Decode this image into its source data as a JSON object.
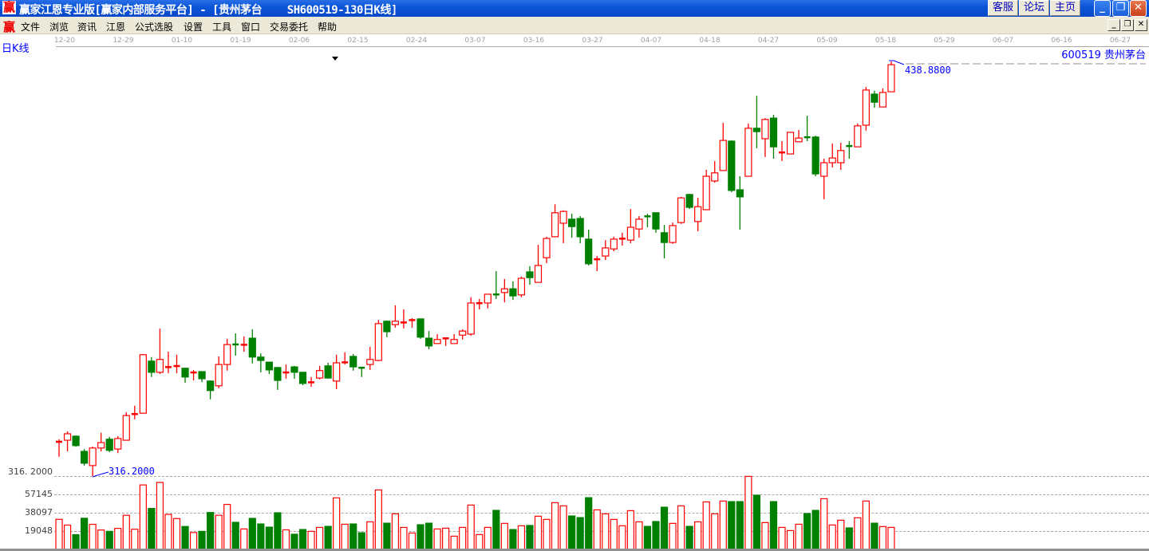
{
  "window": {
    "app_icon": "赢",
    "title": "赢家江恩专业版[赢家内部服务平台] - [贵州茅台    SH600519-130日K线]",
    "top_buttons": [
      "客服",
      "论坛",
      "主页"
    ],
    "controls": {
      "minimize": "minimize-icon",
      "restore": "restore-icon",
      "close": "close-icon"
    }
  },
  "menu": {
    "icon": "赢",
    "items": [
      "文件",
      "浏览",
      "资讯",
      "江恩",
      "公式选股",
      "设置",
      "工具",
      "窗口",
      "交易委托",
      "帮助"
    ]
  },
  "chart": {
    "period_label": "日K线",
    "stock_label": "600519 贵州茅台",
    "date_labels": [
      "12-20",
      "12-29",
      "01-10",
      "01-19",
      "02-06",
      "02-15",
      "02-24",
      "03-07",
      "03-16",
      "03-27",
      "04-07",
      "04-18",
      "04-27",
      "05-09",
      "05-18",
      "05-29",
      "06-07",
      "06-16",
      "06-27"
    ],
    "high_marker": "438.8800",
    "low_marker": "316.2000",
    "price_axis_label": "316. 2000",
    "volume_axis_labels": [
      "57145",
      "38097",
      "19048"
    ],
    "colors": {
      "up": "#FF0000",
      "down": "#008000",
      "marker": "#0000FF"
    }
  },
  "chart_data": {
    "type": "candlestick",
    "ohlc_order": [
      "open",
      "high",
      "low",
      "close"
    ],
    "price_range": [
      316.2,
      438.88
    ],
    "volume_ticks": [
      19048,
      38097,
      57145,
      76193
    ],
    "candles": [
      [
        326.2,
        327.1,
        321.9,
        326.4
      ],
      [
        326.8,
        329.4,
        323.5,
        328.7
      ],
      [
        328.0,
        328.2,
        324.9,
        325.2
      ],
      [
        323.5,
        324.2,
        319.3,
        320.0
      ],
      [
        319.3,
        324.9,
        316.2,
        324.5
      ],
      [
        324.5,
        329.0,
        323.5,
        326.1
      ],
      [
        327.1,
        327.8,
        323.3,
        323.8
      ],
      [
        324.2,
        328.0,
        323.0,
        327.3
      ],
      [
        326.8,
        335.1,
        326.8,
        334.1
      ],
      [
        334.5,
        337.0,
        333.0,
        334.6
      ],
      [
        334.8,
        352.3,
        334.8,
        352.1
      ],
      [
        350.2,
        351.4,
        345.5,
        346.9
      ],
      [
        346.9,
        359.8,
        346.4,
        350.7
      ],
      [
        348.1,
        353.0,
        346.6,
        348.5
      ],
      [
        348.7,
        352.1,
        346.6,
        348.8
      ],
      [
        348.1,
        348.1,
        343.8,
        345.5
      ],
      [
        346.8,
        347.6,
        344.5,
        346.9
      ],
      [
        347.1,
        347.1,
        344.0,
        345.0
      ],
      [
        344.3,
        344.5,
        338.9,
        341.5
      ],
      [
        342.9,
        351.6,
        342.2,
        349.2
      ],
      [
        349.2,
        356.8,
        347.4,
        355.1
      ],
      [
        355.2,
        358.4,
        351.8,
        355.1
      ],
      [
        355.0,
        357.5,
        353.0,
        355.1
      ],
      [
        357.0,
        359.6,
        349.5,
        351.4
      ],
      [
        351.4,
        352.5,
        346.9,
        350.4
      ],
      [
        349.9,
        349.9,
        346.4,
        347.6
      ],
      [
        348.3,
        348.5,
        341.7,
        344.5
      ],
      [
        346.4,
        349.2,
        345.0,
        346.9
      ],
      [
        348.5,
        348.8,
        345.0,
        346.9
      ],
      [
        346.9,
        346.9,
        343.1,
        343.6
      ],
      [
        343.9,
        345.5,
        342.6,
        344.0
      ],
      [
        345.2,
        348.8,
        344.8,
        347.4
      ],
      [
        348.8,
        349.7,
        345.0,
        345.2
      ],
      [
        344.3,
        352.1,
        341.9,
        349.7
      ],
      [
        349.8,
        352.8,
        349.2,
        349.9
      ],
      [
        351.6,
        352.3,
        347.4,
        348.5
      ],
      [
        348.3,
        348.3,
        345.5,
        348.2
      ],
      [
        349.2,
        354.4,
        347.6,
        350.7
      ],
      [
        350.4,
        362.4,
        350.2,
        361.3
      ],
      [
        362.0,
        362.2,
        357.3,
        358.9
      ],
      [
        361.0,
        366.7,
        360.1,
        362.0
      ],
      [
        361.3,
        365.5,
        359.9,
        361.7
      ],
      [
        362.3,
        362.9,
        360.1,
        362.4
      ],
      [
        362.7,
        362.7,
        356.8,
        357.3
      ],
      [
        357.0,
        359.1,
        353.7,
        354.7
      ],
      [
        355.4,
        358.2,
        355.4,
        356.6
      ],
      [
        356.9,
        357.0,
        354.7,
        357.0
      ],
      [
        355.4,
        358.2,
        355.4,
        356.6
      ],
      [
        357.9,
        359.6,
        356.6,
        359.1
      ],
      [
        358.2,
        369.1,
        357.7,
        367.4
      ],
      [
        367.3,
        368.6,
        365.5,
        367.4
      ],
      [
        367.4,
        370.0,
        365.8,
        370.0
      ],
      [
        370.0,
        376.8,
        368.6,
        369.9
      ],
      [
        370.5,
        374.5,
        367.6,
        371.6
      ],
      [
        371.6,
        373.8,
        368.3,
        369.5
      ],
      [
        369.8,
        375.2,
        369.1,
        374.7
      ],
      [
        376.6,
        378.3,
        372.8,
        374.9
      ],
      [
        373.5,
        384.6,
        373.5,
        378.5
      ],
      [
        380.8,
        387.0,
        379.2,
        386.5
      ],
      [
        387.0,
        396.6,
        387.0,
        394.1
      ],
      [
        391.0,
        394.8,
        385.1,
        394.5
      ],
      [
        392.2,
        393.8,
        386.7,
        390.0
      ],
      [
        392.4,
        393.1,
        385.1,
        387.0
      ],
      [
        386.3,
        389.1,
        378.5,
        379.0
      ],
      [
        380.3,
        381.3,
        376.8,
        380.4
      ],
      [
        381.3,
        386.0,
        380.1,
        383.7
      ],
      [
        383.4,
        387.0,
        382.7,
        386.3
      ],
      [
        386.4,
        388.2,
        384.4,
        386.5
      ],
      [
        386.0,
        395.2,
        385.1,
        389.8
      ],
      [
        389.3,
        393.1,
        386.7,
        392.2
      ],
      [
        393.1,
        393.8,
        389.8,
        393.0
      ],
      [
        394.1,
        394.1,
        388.2,
        389.3
      ],
      [
        388.2,
        390.5,
        380.6,
        385.3
      ],
      [
        385.3,
        391.2,
        384.9,
        390.3
      ],
      [
        391.2,
        398.8,
        390.8,
        398.5
      ],
      [
        399.5,
        399.7,
        395.2,
        395.7
      ],
      [
        391.5,
        398.5,
        388.6,
        395.9
      ],
      [
        395.0,
        406.8,
        395.0,
        404.9
      ],
      [
        403.5,
        409.4,
        403.0,
        405.9
      ],
      [
        406.6,
        420.7,
        406.6,
        415.5
      ],
      [
        415.3,
        415.5,
        400.2,
        400.7
      ],
      [
        400.9,
        404.9,
        389.1,
        398.8
      ],
      [
        404.9,
        420.5,
        404.9,
        419.1
      ],
      [
        419.1,
        428.7,
        413.2,
        418.1
      ],
      [
        416.0,
        422.1,
        410.6,
        421.7
      ],
      [
        422.1,
        423.1,
        410.1,
        413.6
      ],
      [
        411.9,
        415.3,
        409.4,
        412.0
      ],
      [
        411.5,
        417.9,
        411.5,
        417.9
      ],
      [
        415.1,
        418.6,
        415.1,
        416.2
      ],
      [
        416.5,
        422.8,
        415.3,
        416.4
      ],
      [
        416.5,
        416.9,
        404.9,
        405.6
      ],
      [
        404.9,
        410.1,
        398.1,
        408.9
      ],
      [
        408.9,
        414.6,
        407.5,
        410.3
      ],
      [
        408.9,
        414.8,
        406.8,
        412.5
      ],
      [
        413.9,
        415.3,
        410.1,
        413.8
      ],
      [
        413.6,
        420.5,
        413.6,
        419.8
      ],
      [
        420.0,
        431.3,
        418.4,
        430.4
      ],
      [
        429.2,
        430.2,
        425.2,
        426.8
      ],
      [
        425.4,
        430.9,
        425.4,
        429.7
      ],
      [
        429.9,
        438.88,
        429.9,
        437.9
      ]
    ],
    "volumes": [
      31000,
      25000,
      15050,
      32100,
      25800,
      19900,
      18500,
      21600,
      35200,
      20700,
      66700,
      42300,
      69300,
      36100,
      31800,
      23600,
      17300,
      18500,
      38100,
      35200,
      46500,
      27900,
      21000,
      32000,
      26200,
      22900,
      37800,
      20100,
      15500,
      20400,
      18500,
      22600,
      23700,
      53300,
      25900,
      26200,
      17100,
      28400,
      61500,
      27000,
      36700,
      22600,
      16800,
      25400,
      27000,
      21000,
      21800,
      13500,
      22600,
      45800,
      15200,
      22600,
      40300,
      26800,
      20400,
      24300,
      24600,
      34200,
      30900,
      48300,
      45000,
      34500,
      32800,
      53500,
      40800,
      36700,
      30900,
      24300,
      40000,
      28400,
      23700,
      28700,
      43600,
      26800,
      45000,
      23700,
      28400,
      49100,
      36700,
      50000,
      49400,
      49400,
      75600,
      56000,
      27600,
      49400,
      22600,
      19300,
      25900,
      37000,
      40300,
      52400,
      25100,
      30100,
      22100,
      32600,
      50000,
      27000,
      23500,
      22600
    ]
  }
}
